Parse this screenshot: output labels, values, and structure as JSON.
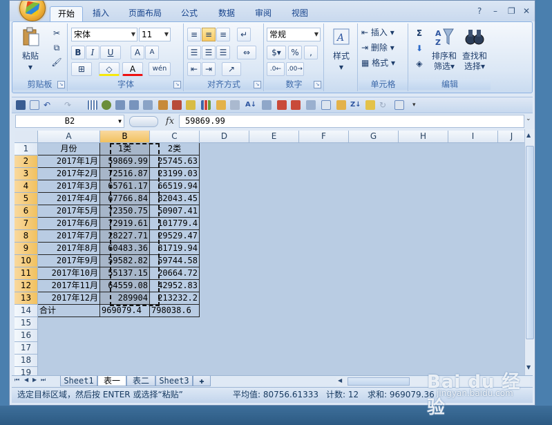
{
  "ribbon_tabs": [
    "开始",
    "插入",
    "页面布局",
    "公式",
    "数据",
    "审阅",
    "视图"
  ],
  "active_tab": "开始",
  "clipboard": {
    "paste_label": "粘贴",
    "group_label": "剪贴板"
  },
  "font": {
    "name": "宋体",
    "size": "11",
    "bold": "B",
    "italic": "I",
    "underline": "U",
    "grow": "A",
    "shrink": "A",
    "font_color": "A",
    "phonetic": "wén",
    "group_label": "字体"
  },
  "alignment": {
    "group_label": "对齐方式"
  },
  "number": {
    "format": "常规",
    "percent": "%",
    "comma": ",",
    "group_label": "数字"
  },
  "styles": {
    "label": "样式"
  },
  "cells": {
    "insert": "插入",
    "delete": "删除",
    "format": "格式",
    "group_label": "单元格"
  },
  "editing": {
    "sigma": "Σ",
    "sort_filter_line1": "排序和",
    "sort_filter_line2": "筛选",
    "find_select_line1": "查找和",
    "find_select_line2": "选择",
    "group_label": "编辑"
  },
  "formula_bar": {
    "name_box": "B2",
    "fx": "fx",
    "value": "59869.99"
  },
  "columns": [
    "A",
    "B",
    "C",
    "D",
    "E",
    "F",
    "G",
    "H",
    "I",
    "J"
  ],
  "rows": [
    "1",
    "2",
    "3",
    "4",
    "5",
    "6",
    "7",
    "8",
    "9",
    "10",
    "11",
    "12",
    "13",
    "14",
    "15",
    "16",
    "17",
    "18",
    "19"
  ],
  "table": {
    "headers": [
      "月份",
      "1类",
      "2类"
    ],
    "data": [
      [
        "2017年1月",
        "59869.99",
        "25745.63"
      ],
      [
        "2017年2月",
        "72516.87",
        "23199.03"
      ],
      [
        "2017年3月",
        "65761.17",
        "66519.94"
      ],
      [
        "2017年4月",
        "67766.84",
        "82043.45"
      ],
      [
        "2017年5月",
        "72350.75",
        "50907.41"
      ],
      [
        "2017年6月",
        "72919.61",
        "101779.4"
      ],
      [
        "2017年7月",
        "28227.71",
        "29529.47"
      ],
      [
        "2017年8月",
        "60483.36",
        "81719.94"
      ],
      [
        "2017年9月",
        "59582.82",
        "59744.58"
      ],
      [
        "2017年10月",
        "55137.15",
        "20664.72"
      ],
      [
        "2017年11月",
        "64559.08",
        "42952.83"
      ],
      [
        "2017年12月",
        "289904",
        "213232.2"
      ]
    ],
    "total": [
      "合计",
      "969079.4",
      "798038.6"
    ]
  },
  "sheet_tabs": [
    "Sheet1",
    "表一",
    "表二",
    "Sheet3"
  ],
  "active_sheet": "表一",
  "status": {
    "message": "选定目标区域，然后按 ENTER 或选择“粘贴”",
    "average": "平均值: 80756.61333",
    "count": "计数: 12",
    "sum": "求和: 969079.36"
  },
  "watermark": {
    "brand": "Bai du 经验",
    "url": "jingyan.baidu.com"
  },
  "colors": {
    "selection_header": "#f1c15f",
    "sheet_bg": "#b9cce3",
    "ribbon_text": "#15428b"
  }
}
